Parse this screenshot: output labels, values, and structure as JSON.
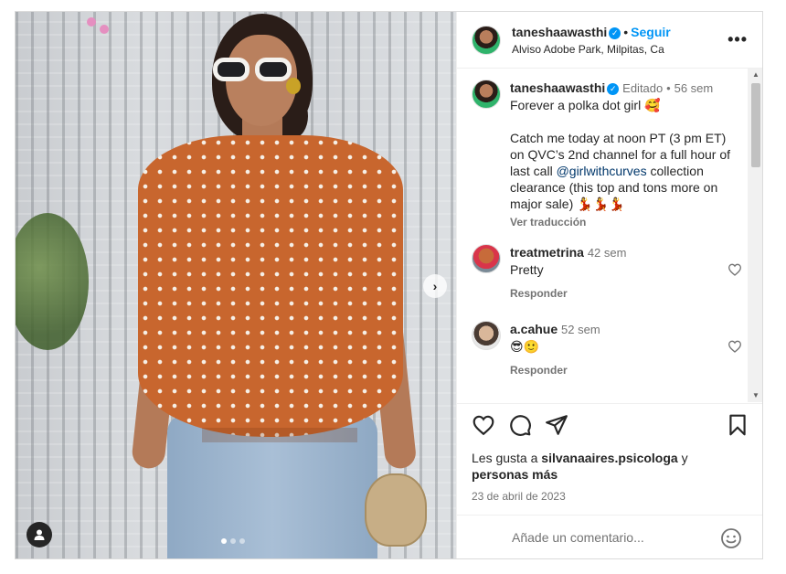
{
  "post": {
    "author": {
      "username": "taneshaawasthi",
      "verified": true,
      "follow_label": "Seguir",
      "location": "Alviso Adobe Park, Milpitas, Ca"
    },
    "media": {
      "carousel_index": 1,
      "carousel_count": 3
    },
    "caption": {
      "username": "taneshaawasthi",
      "edited_label": "Editado",
      "time": "56 sem",
      "line1": "Forever a polka dot girl 🥰",
      "text_before_mention": "Catch me today at noon PT (3 pm ET) on QVC’s 2nd channel for a full hour of last call ",
      "mention": "@girlwithcurves",
      "text_after_mention": " collection clearance (this top and tons more on major sale) 💃💃💃",
      "translate_label": "Ver traducción"
    },
    "comments": [
      {
        "username": "treatmetrina",
        "time": "42 sem",
        "text": "Pretty",
        "reply_label": "Responder"
      },
      {
        "username": "a.cahue",
        "time": "52 sem",
        "text": "😎🙂",
        "reply_label": "Responder"
      }
    ],
    "likes": {
      "prefix": "Les gusta a ",
      "user": "silvanaaires.psicologa",
      "connector": " y ",
      "suffix": "personas más"
    },
    "date": "23 de abril de 2023",
    "add_comment_placeholder": "Añade un comentario..."
  },
  "icons": {
    "verified": "verified-badge-icon",
    "more": "more-options-icon",
    "like": "heart-icon",
    "comment": "comment-icon",
    "share": "share-icon",
    "save": "bookmark-icon",
    "emoji": "emoji-icon",
    "tag": "user-tag-icon",
    "next": "chevron-right-icon"
  },
  "colors": {
    "link": "#0095f6",
    "mention": "#00376b",
    "muted": "#737373",
    "text": "#262626"
  }
}
